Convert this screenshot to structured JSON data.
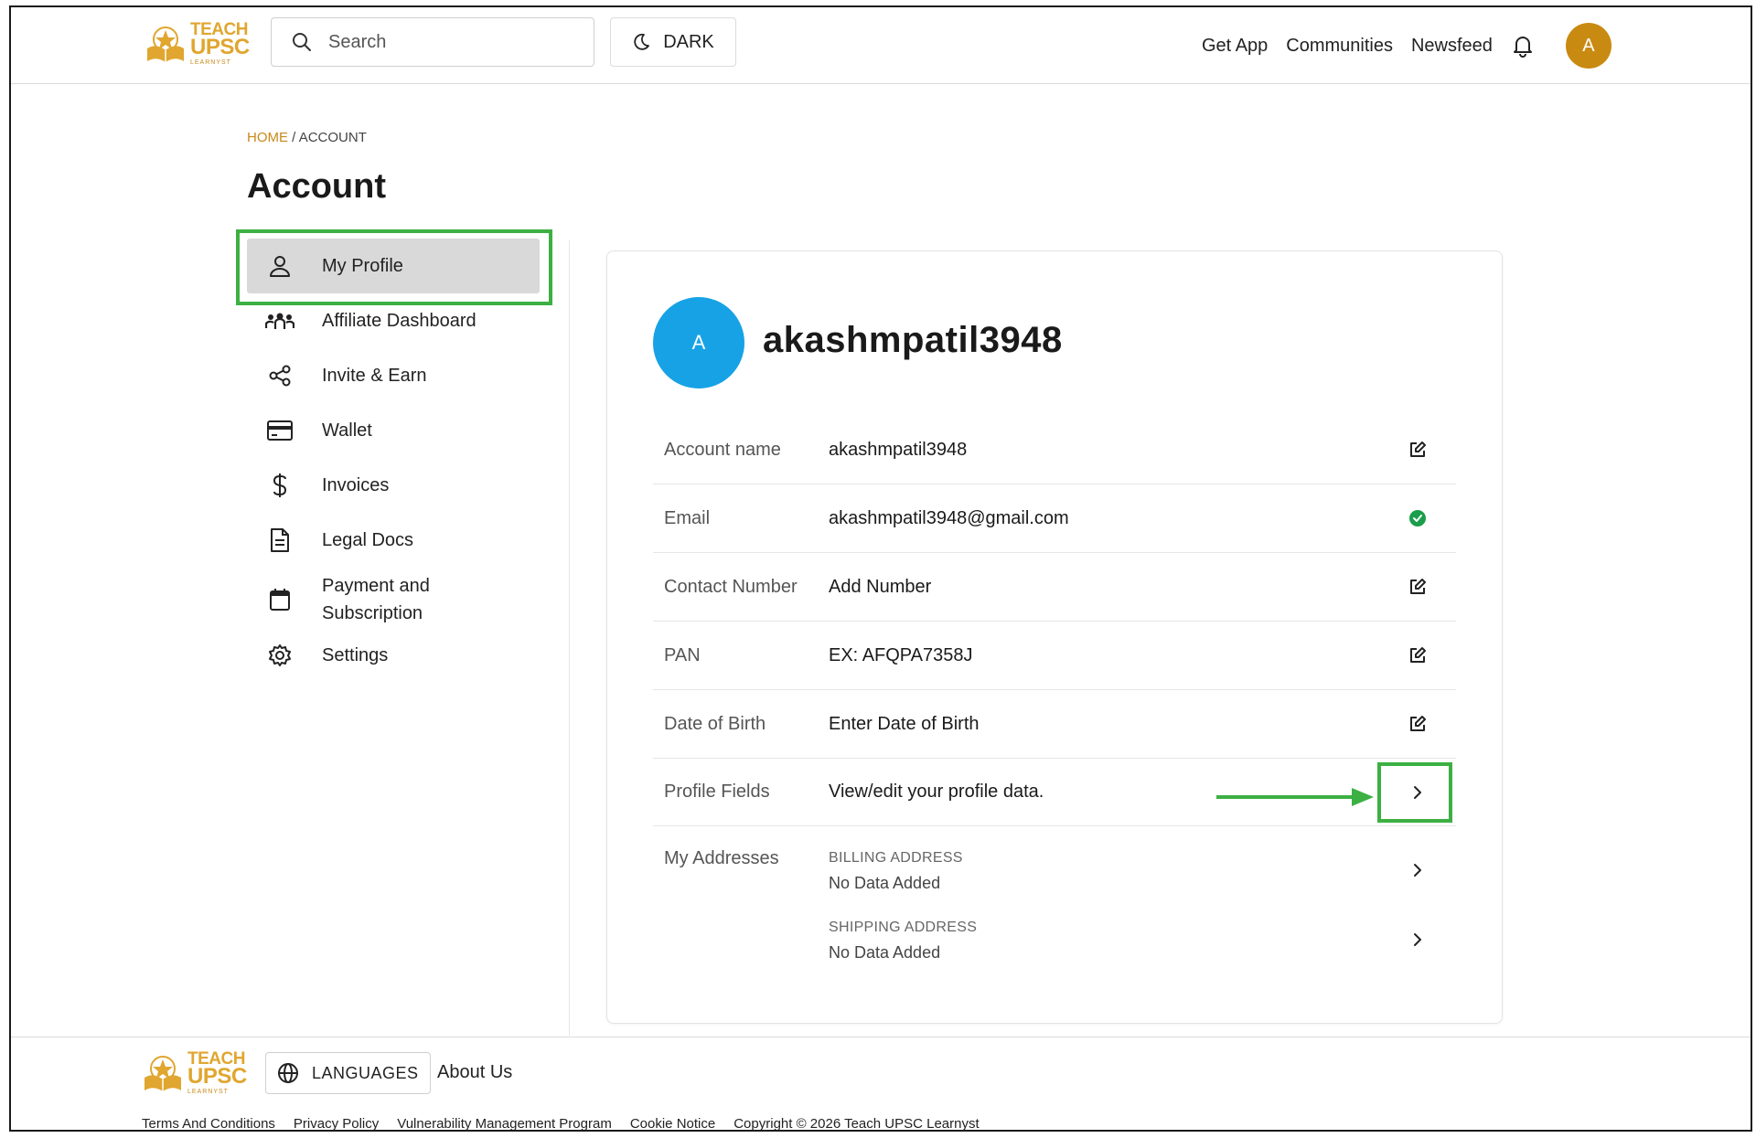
{
  "header": {
    "logo": {
      "line1": "TEACH",
      "line2": "UPSC",
      "line3": "LEARNYST"
    },
    "search_placeholder": "Search",
    "dark_label": "DARK",
    "nav": [
      "Get App",
      "Communities",
      "Newsfeed"
    ],
    "avatar_initial": "A"
  },
  "breadcrumb": {
    "home": "HOME",
    "sep": "/",
    "current": "ACCOUNT"
  },
  "page_title": "Account",
  "sidebar": {
    "items": [
      {
        "label": "My Profile",
        "icon": "user-icon"
      },
      {
        "label": "Affiliate Dashboard",
        "icon": "group-icon"
      },
      {
        "label": "Invite & Earn",
        "icon": "share-icon"
      },
      {
        "label": "Wallet",
        "icon": "card-icon"
      },
      {
        "label": "Invoices",
        "icon": "dollar-icon"
      },
      {
        "label": "Legal Docs",
        "icon": "document-icon"
      },
      {
        "label": "Payment and Subscription",
        "icon": "calendar-icon"
      },
      {
        "label": "Settings",
        "icon": "gear-icon"
      }
    ]
  },
  "profile": {
    "avatar_initial": "A",
    "username": "akashmpatil3948",
    "rows": [
      {
        "key": "Account name",
        "value": "akashmpatil3948",
        "action": "edit-icon"
      },
      {
        "key": "Email",
        "value": "akashmpatil3948@gmail.com",
        "action": "verified-check-icon"
      },
      {
        "key": "Contact Number",
        "value": "Add Number",
        "action": "edit-icon"
      },
      {
        "key": "PAN",
        "value": "EX: AFQPA7358J",
        "action": "edit-icon"
      },
      {
        "key": "Date of Birth",
        "value": "Enter Date of Birth",
        "action": "edit-icon"
      },
      {
        "key": "Profile Fields",
        "value": "View/edit your profile data.",
        "action": "chevron-right-icon"
      }
    ],
    "addresses": {
      "key": "My Addresses",
      "billing": {
        "caption": "BILLING ADDRESS",
        "value": "No Data Added"
      },
      "shipping": {
        "caption": "SHIPPING ADDRESS",
        "value": "No Data Added"
      }
    }
  },
  "footer": {
    "logo": {
      "line1": "TEACH",
      "line2": "UPSC",
      "line3": "LEARNYST"
    },
    "languages_label": "LANGUAGES",
    "about": "About Us",
    "links": [
      "Terms And Conditions",
      "Privacy Policy",
      "Vulnerability Management Program",
      "Cookie Notice",
      "Copyright © 2026 Teach UPSC Learnyst"
    ]
  },
  "colors": {
    "accent": "#c8891b",
    "highlight": "#3cb043",
    "avatar_blue": "#17a2e6",
    "verified": "#1a9e4b"
  }
}
